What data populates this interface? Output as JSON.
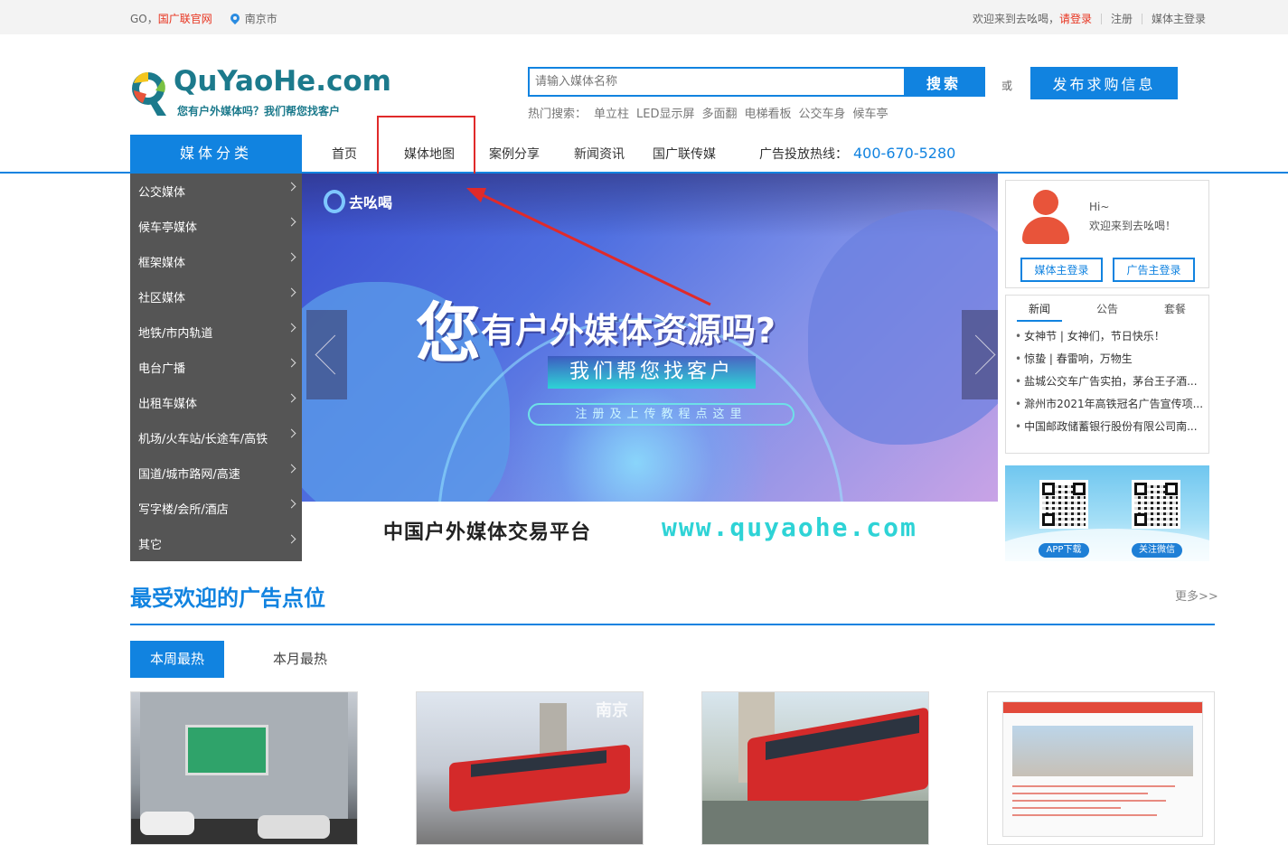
{
  "topbar": {
    "go_prefix": "GO，",
    "go_link": "国广联官网",
    "city": "南京市",
    "welcome": "欢迎来到去吆喝，",
    "login": "请登录",
    "register": "注册",
    "media_login": "媒体主登录"
  },
  "logo": {
    "text": "QuYaoHe.com",
    "slogan": "您有户外媒体吗？我们帮您找客户"
  },
  "search": {
    "placeholder": "请输入媒体名称",
    "button": "搜索",
    "or": "或",
    "publish": "发布求购信息",
    "hot_label": "热门搜索：",
    "hot_keywords": [
      "单立柱",
      "LED显示屏",
      "多面翻",
      "电梯看板",
      "公交车身",
      "候车亭"
    ]
  },
  "nav": {
    "category_title": "媒体分类",
    "items": [
      "首页",
      "媒体地图",
      "案例分享",
      "新闻资讯",
      "国广联传媒"
    ],
    "hotline_label": "广告投放热线：",
    "hotline": "400-670-5280"
  },
  "categories": [
    "公交媒体",
    "候车亭媒体",
    "框架媒体",
    "社区媒体",
    "地铁/市内轨道",
    "电台广播",
    "出租车媒体",
    "机场/火车站/长途车/高铁",
    "国道/城市路网/高速",
    "写字楼/会所/酒店",
    "其它"
  ],
  "banner": {
    "brand": "去吆喝",
    "headline_big": "您",
    "headline_rest": "有户外媒体资源吗?",
    "sub": "我们帮您找客户",
    "guide": "注册及上传教程点这里",
    "strip_cn": "中国户外媒体交易平台",
    "strip_url": "www.quyaohe.com"
  },
  "user_panel": {
    "hi": "Hi~",
    "welcome": "欢迎来到去吆喝！",
    "media_login": "媒体主登录",
    "ad_login": "广告主登录"
  },
  "news": {
    "tabs": [
      "新闻",
      "公告",
      "套餐"
    ],
    "items": [
      "女神节 | 女神们，节日快乐！",
      "惊蛰 | 春雷响，万物生",
      "盐城公交车广告实拍，茅台王子酒...",
      "滁州市2021年高铁冠名广告宣传项...",
      "中国邮政储蓄银行股份有限公司南..."
    ]
  },
  "qr": {
    "app": "APP下载",
    "wechat": "关注微信"
  },
  "section": {
    "title": "最受欢迎的广告点位",
    "more": "更多>>",
    "tab_week": "本周最热",
    "tab_month": "本月最热",
    "card2_watermark": "南京"
  },
  "colors": {
    "accent": "#1183e0",
    "red": "#e8331f",
    "sidebar": "#555555"
  }
}
